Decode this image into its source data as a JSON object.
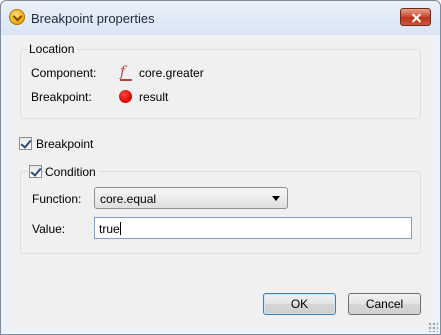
{
  "window": {
    "title": "Breakpoint properties"
  },
  "location": {
    "legend": "Location",
    "component_label": "Component:",
    "component_value": "core.greater",
    "component_icon": "function-icon",
    "breakpoint_label": "Breakpoint:",
    "breakpoint_value": "result",
    "breakpoint_icon": "breakpoint-dot-icon"
  },
  "breakpoint_checkbox": {
    "label": "Breakpoint",
    "checked": true
  },
  "condition": {
    "checkbox_label": "Condition",
    "checked": true,
    "function_label": "Function:",
    "function_value": "core.equal",
    "value_label": "Value:",
    "value_text": "true"
  },
  "buttons": {
    "ok": "OK",
    "cancel": "Cancel"
  },
  "colors": {
    "breakpoint_dot": "#d40000",
    "function_icon": "#b5473a"
  }
}
